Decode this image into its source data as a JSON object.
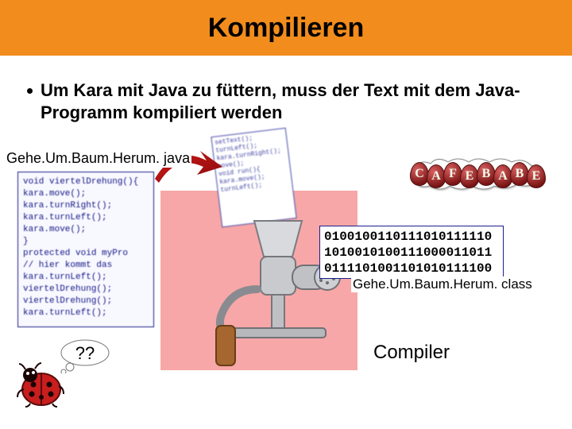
{
  "title": "Kompilieren",
  "bullet_text": "Um Kara mit Java zu füttern, muss der Text mit dem Java-Programm kompiliert werden",
  "source_filename": "Gehe.Um.Baum.Herum. java",
  "class_filename": "Gehe.Um.Baum.Herum. class",
  "compiler_label": "Compiler",
  "thought": "??",
  "cafebabe_letters": [
    "C",
    "A",
    "F",
    "E",
    "B",
    "A",
    "B",
    "E"
  ],
  "binary_lines": [
    "0100100110111010111110",
    "1010010100111000011011",
    "0111101001101010111100"
  ],
  "source_code_lines": [
    "void viertelDrehung(){",
    "  kara.move();",
    "  kara.turnRight();",
    "  kara.turnLeft();",
    "  kara.move();",
    "}",
    "",
    "protected void myPro",
    "  // hier kommt das",
    "  kara.turnLeft();",
    "  viertelDrehung();",
    "  viertelDrehung();",
    "  kara.turnLeft();"
  ],
  "frag_code_lines": [
    "setText();",
    "turnLeft();",
    "kara.turnRight();",
    "move();",
    "void run(){",
    "kara.move();",
    "turnLeft();"
  ]
}
